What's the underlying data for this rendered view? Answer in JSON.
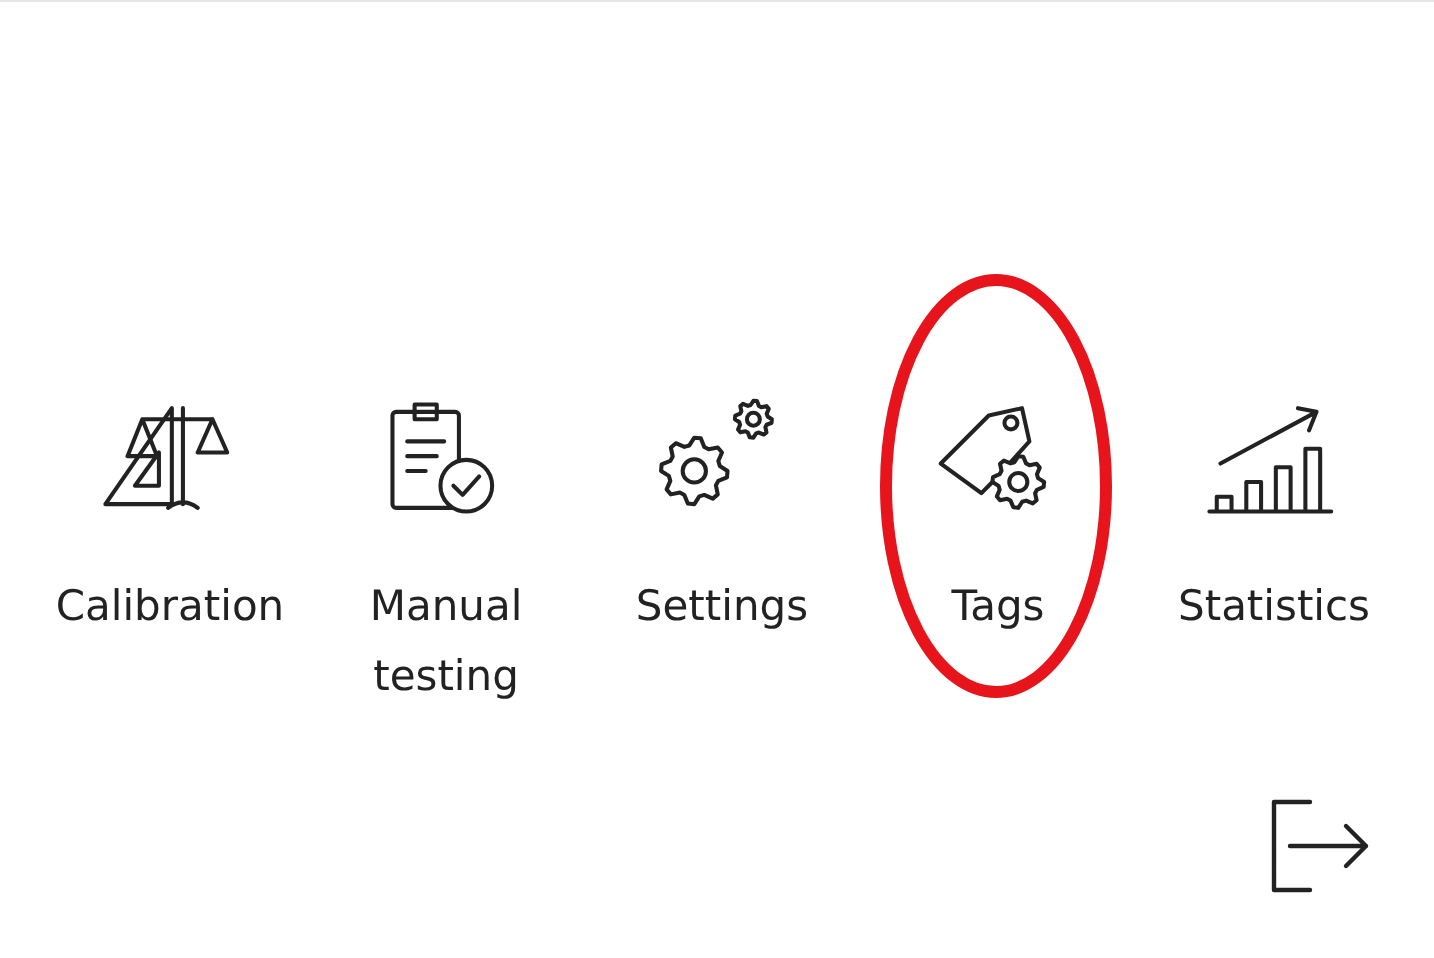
{
  "menu_items": [
    {
      "kind": "calibration",
      "label": "Calibration",
      "highlighted": false
    },
    {
      "kind": "manual_testing",
      "label": "Manual testing",
      "highlighted": false
    },
    {
      "kind": "settings",
      "label": "Settings",
      "highlighted": false
    },
    {
      "kind": "tags",
      "label": "Tags",
      "highlighted": true
    },
    {
      "kind": "statistics",
      "label": "Statistics",
      "highlighted": false
    }
  ],
  "logout": {
    "kind": "logout"
  }
}
